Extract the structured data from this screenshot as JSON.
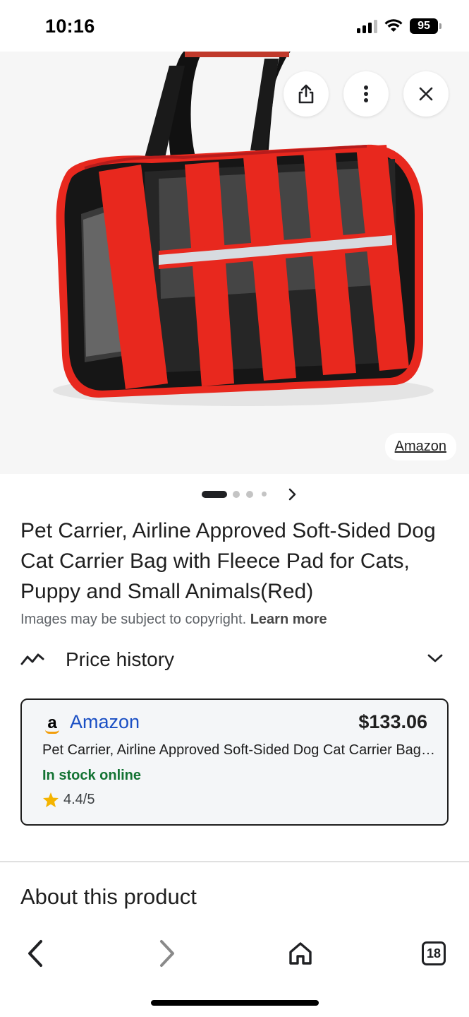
{
  "status_bar": {
    "time": "10:16",
    "battery": "95"
  },
  "hero": {
    "source_label": "Amazon",
    "share_icon": "share-icon",
    "more_icon": "more-vert-icon",
    "close_icon": "close-icon",
    "pager": {
      "pages": 4,
      "current": 1
    }
  },
  "product": {
    "title": "Pet Carrier, Airline Approved Soft-Sided Dog Cat Carrier Bag with Fleece Pad for Cats, Puppy and Small Animals(Red)",
    "copyright_text": "Images may be subject to copyright.",
    "learn_more": "Learn more"
  },
  "price_history": {
    "label": "Price history"
  },
  "offer": {
    "seller": "Amazon",
    "price": "$133.06",
    "description": "Pet Carrier, Airline Approved Soft-Sided Dog Cat Carrier Bag with Fleece Pad for Cats, Puppy and Small Animals(Red)",
    "stock": "In stock online",
    "rating": "4.4/5"
  },
  "about": {
    "heading": "About this product"
  },
  "bottom_nav": {
    "tab_count": "18"
  },
  "colors": {
    "seller_link": "#1a4fc4",
    "in_stock": "#137333",
    "star": "#f4b400"
  }
}
